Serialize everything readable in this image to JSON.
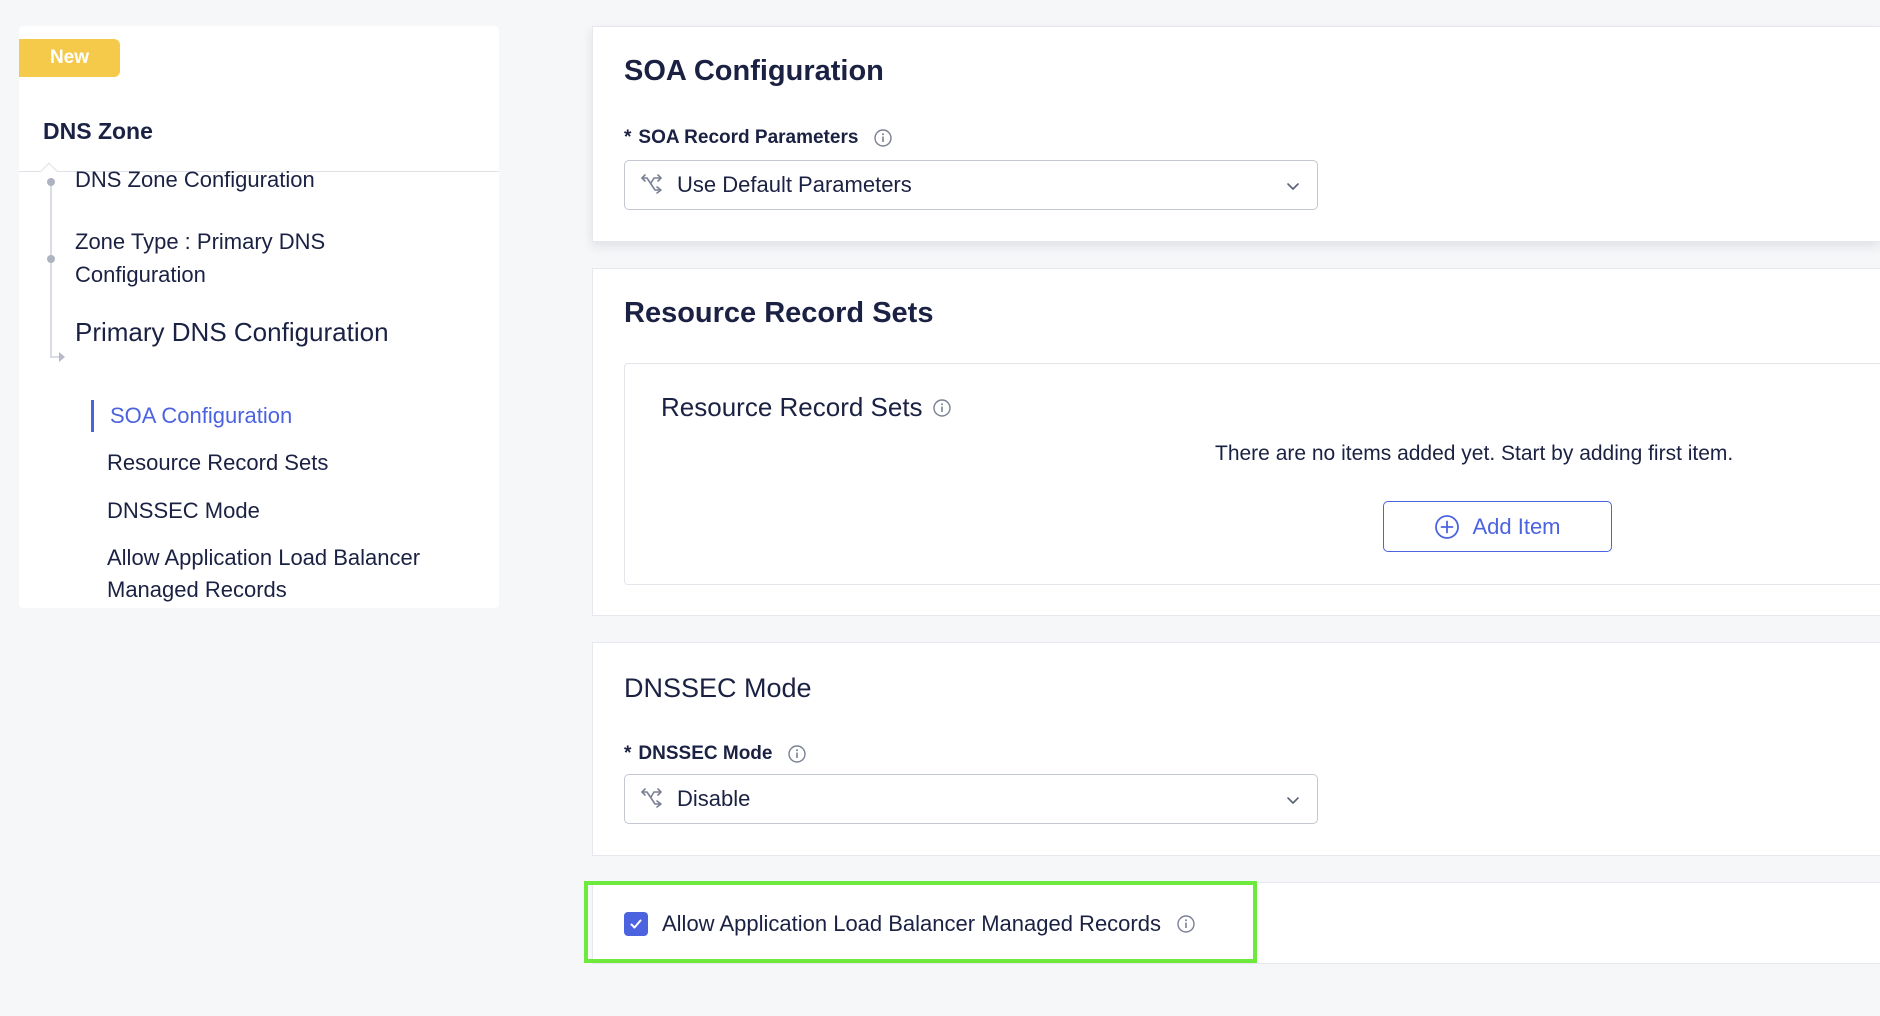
{
  "sidebar": {
    "badge": "New",
    "title": "DNS Zone",
    "items": [
      {
        "label": "DNS Zone Configuration"
      },
      {
        "label": "Zone Type : Primary DNS\nConfiguration"
      },
      {
        "label": "Primary DNS Configuration"
      }
    ],
    "subitems": [
      {
        "label": "SOA Configuration",
        "active": true
      },
      {
        "label": "Resource Record Sets"
      },
      {
        "label": "DNSSEC Mode"
      },
      {
        "label": "Allow Application Load Balancer\nManaged Records"
      }
    ]
  },
  "soa": {
    "title": "SOA Configuration",
    "field_label": "SOA Record Parameters",
    "required_mark": "*",
    "selected": "Use Default Parameters"
  },
  "rrs": {
    "title": "Resource Record Sets",
    "inner_title": "Resource Record Sets",
    "empty_text": "There are no items added yet. Start by adding first item.",
    "add_label": "Add Item"
  },
  "dnssec": {
    "title": "DNSSEC Mode",
    "field_label": "DNSSEC Mode",
    "required_mark": "*",
    "selected": "Disable"
  },
  "alb": {
    "checkbox_label": "Allow Application Load Balancer Managed Records",
    "checked": true
  },
  "colors": {
    "accent": "#4c63e0",
    "badge": "#f5c94a",
    "highlight": "#6dea3d",
    "text": "#1b2142"
  }
}
